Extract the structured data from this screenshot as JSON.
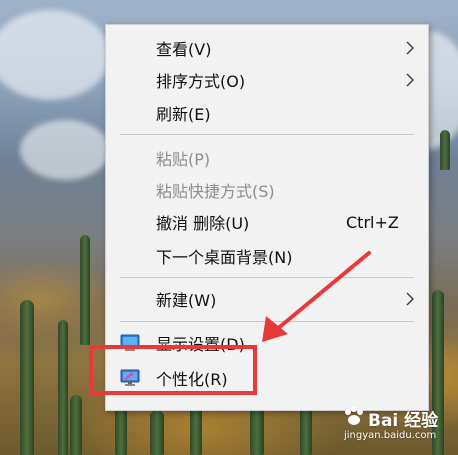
{
  "context_menu": {
    "items": [
      {
        "label": "查看(V)",
        "has_submenu": true
      },
      {
        "label": "排序方式(O)",
        "has_submenu": true
      },
      {
        "label": "刷新(E)"
      },
      {
        "label": "粘贴(P)",
        "disabled": true
      },
      {
        "label": "粘贴快捷方式(S)",
        "disabled": true
      },
      {
        "label": "撤消 删除(U)",
        "shortcut": "Ctrl+Z"
      },
      {
        "label": "下一个桌面背景(N)"
      },
      {
        "label": "新建(W)",
        "has_submenu": true
      },
      {
        "label": "显示设置(D)",
        "icon": "display-settings-icon"
      },
      {
        "label": "个性化(R)",
        "icon": "personalize-icon"
      }
    ]
  },
  "annotation": {
    "highlight_color": "#e8383a",
    "highlighted_item": "个性化(R)"
  },
  "watermark": {
    "main": "Bai 经验",
    "sub": "jingyan.baidu.com"
  }
}
